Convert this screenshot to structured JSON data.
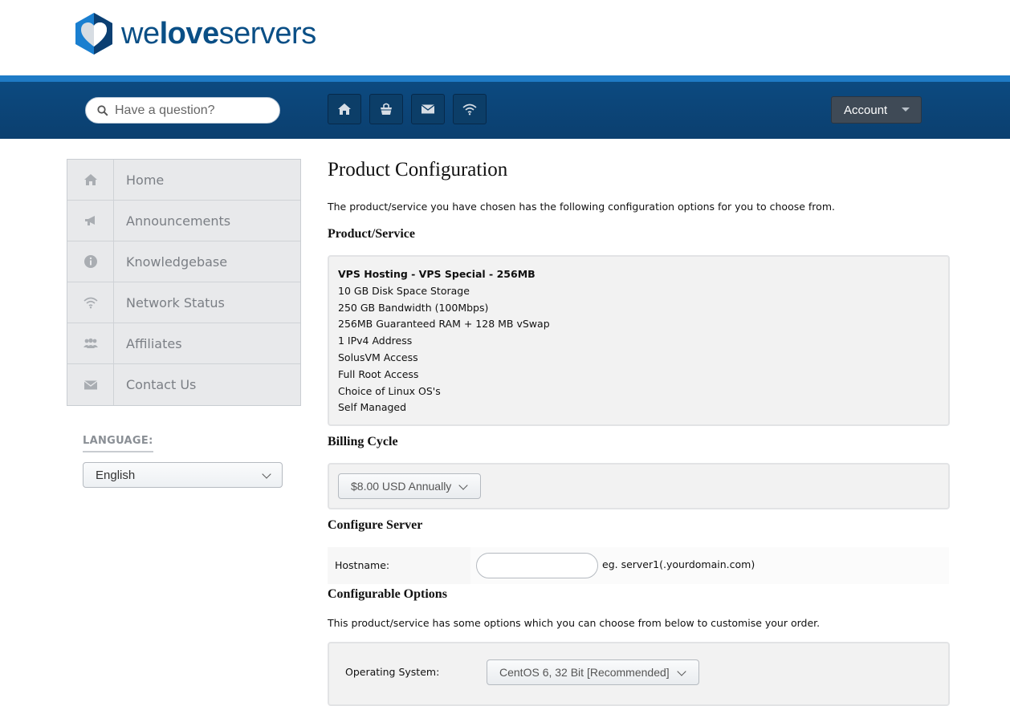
{
  "brand": {
    "part1": "we",
    "part2": "love",
    "part3": "servers"
  },
  "header": {
    "search_placeholder": "Have a question?",
    "nav_icons": [
      "home-icon",
      "basket-icon",
      "mail-icon",
      "wifi-icon"
    ],
    "account_label": "Account"
  },
  "sidebar": {
    "items": [
      {
        "label": "Home",
        "icon": "home-icon"
      },
      {
        "label": "Announcements",
        "icon": "megaphone-icon"
      },
      {
        "label": "Knowledgebase",
        "icon": "info-icon"
      },
      {
        "label": "Network Status",
        "icon": "wifi-icon"
      },
      {
        "label": "Affiliates",
        "icon": "users-icon"
      },
      {
        "label": "Contact Us",
        "icon": "mail-icon"
      }
    ],
    "language_label": "LANGUAGE:",
    "language_value": "English"
  },
  "main": {
    "title": "Product Configuration",
    "intro": "The product/service you have chosen has the following configuration options for you to choose from.",
    "product_heading": "Product/Service",
    "product": {
      "name": "VPS Hosting - VPS Special - 256MB",
      "features": [
        "10 GB Disk Space Storage",
        "250 GB Bandwidth (100Mbps)",
        "256MB Guaranteed RAM + 128 MB vSwap",
        "1 IPv4 Address",
        "SolusVM Access",
        "Full Root Access",
        "Choice of Linux OS's",
        "Self Managed"
      ]
    },
    "billing_heading": "Billing Cycle",
    "billing_value": "$8.00 USD Annually",
    "server_heading": "Configure Server",
    "hostname_label": "Hostname:",
    "hostname_value": "",
    "hostname_hint": "eg. server1(.yourdomain.com)",
    "options_heading": "Configurable Options",
    "options_intro": "This product/service has some options which you can choose from below to customise your order.",
    "os_label": "Operating System:",
    "os_value": "CentOS 6, 32 Bit [Recommended]"
  },
  "colors": {
    "brand_blue": "#0a4f86",
    "topbar": "#0c4a80",
    "accent_stripe": "#1f7bc6",
    "account_bg": "#3f4a56"
  }
}
